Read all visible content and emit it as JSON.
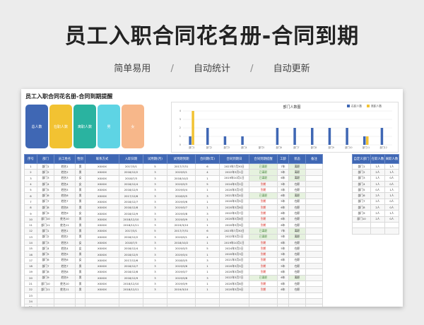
{
  "hero": {
    "title": "员工入职合同花名册-合同到期",
    "features": [
      "简单易用",
      "自动统计",
      "自动更新"
    ],
    "separator": "/"
  },
  "sheet": {
    "title": "员工入职合同花名册-合同到期提醒",
    "cards": [
      {
        "label": "总人数",
        "color": "#3f67b4"
      },
      {
        "label": "在职人数",
        "color": "#f2c232"
      },
      {
        "label": "离职人数",
        "color": "#2ab3a0"
      },
      {
        "label": "男",
        "color": "#5ed4e4"
      },
      {
        "label": "女",
        "color": "#f7b78a"
      }
    ]
  },
  "chart_data": {
    "type": "bar",
    "title": "部门人数图",
    "categories": [
      "部门1",
      "部门2",
      "部门3",
      "部门4",
      "部门5",
      "部门6",
      "部门7",
      "部门8",
      "部门9",
      "部门10",
      "部门11",
      "部门12"
    ],
    "series": [
      {
        "name": "在职人数",
        "color": "#3f67b4",
        "values": [
          1,
          2,
          1,
          1,
          0,
          2,
          2,
          2,
          2,
          2,
          1,
          2
        ]
      },
      {
        "name": "离职人数",
        "color": "#f2c232",
        "values": [
          4,
          0,
          0,
          0,
          0,
          0,
          0,
          0,
          0,
          0,
          1,
          0
        ]
      }
    ],
    "yticks": [
      "0",
      "1",
      "2",
      "3",
      "4"
    ],
    "ylim": [
      0,
      4
    ],
    "legend": "top-right"
  },
  "table": {
    "headers": [
      "序号",
      "部门",
      "员工姓名",
      "性别",
      "联系方式",
      "入职日期",
      "试用期(月)",
      "试用期到期",
      "合同期(年)",
      "合同到期日",
      "合同到期提醒",
      "工龄",
      "状态",
      "备注"
    ],
    "rows": [
      [
        "1",
        "部门1",
        "姓名1",
        "男",
        "XXXXX",
        "2017/3/1",
        "5",
        "2017/7/31",
        "6",
        "2023年7月30日",
        "已离职",
        "7年",
        "离职",
        ""
      ],
      [
        "2",
        "部门2",
        "姓名2",
        "男",
        "XXXXX",
        "2018/12/2",
        "3",
        "2019/3/1",
        "4",
        "2022年3月1日",
        "已离职",
        "5年",
        "离职",
        ""
      ],
      [
        "3",
        "部门3",
        "姓名3",
        "女",
        "XXXXX",
        "2018/7/3",
        "3",
        "2018/10/2",
        "1",
        "2019年10月1日",
        "已离职",
        "6年",
        "离职",
        ""
      ],
      [
        "4",
        "部门4",
        "姓名4",
        "女",
        "XXXXX",
        "2018/12/4",
        "3",
        "2019/3/3",
        "5",
        "2024年3月2日",
        "到期",
        "5年",
        "在职",
        ""
      ],
      [
        "5",
        "部门5",
        "姓名5",
        "男",
        "XXXXX",
        "2018/12/5",
        "3",
        "2019/3/4",
        "1",
        "2020年3月3日",
        "到期",
        "5年",
        "在职",
        ""
      ],
      [
        "6",
        "部门6",
        "姓名6",
        "男",
        "XXXXX",
        "2017/12/6",
        "3",
        "2018/3/5",
        "3",
        "2021年3月4日",
        "已离职",
        "6年",
        "离职",
        ""
      ],
      [
        "7",
        "部门7",
        "姓名7",
        "男",
        "XXXXX",
        "2018/12/7",
        "3",
        "2019/3/6",
        "1",
        "2020年3月5日",
        "到期",
        "5年",
        "在职",
        ""
      ],
      [
        "8",
        "部门8",
        "姓名8",
        "男",
        "XXXXX",
        "2018/12/8",
        "3",
        "2019/3/7",
        "1",
        "2020年3月6日",
        "到期",
        "6年",
        "在职",
        ""
      ],
      [
        "9",
        "部门9",
        "姓名9",
        "女",
        "XXXXX",
        "2018/12/9",
        "3",
        "2019/3/8",
        "3",
        "2022年3月7日",
        "到期",
        "6年",
        "在职",
        ""
      ],
      [
        "10",
        "部门10",
        "姓名10",
        "男",
        "XXXXX",
        "2018/12/10",
        "3",
        "2019/3/9",
        "1",
        "2020年3月8日",
        "到期",
        "6年",
        "在职",
        ""
      ],
      [
        "11",
        "部门11",
        "姓名11",
        "男",
        "XXXXX",
        "2018/12/11",
        "3",
        "2019/3/10",
        "1",
        "2020年3月9日",
        "到期",
        "6年",
        "在职",
        ""
      ],
      [
        "12",
        "部门1",
        "姓名1",
        "男",
        "XXXXX",
        "2017/3/1",
        "5",
        "2017/7/31",
        "6",
        "2023年7月30日",
        "已离职",
        "7年",
        "离职",
        ""
      ],
      [
        "13",
        "部门2",
        "姓名2",
        "男",
        "XXXXX",
        "2018/12/2",
        "3",
        "2019/3/1",
        "4",
        "2022年3月1日",
        "已离职",
        "5年",
        "离职",
        ""
      ],
      [
        "14",
        "部门3",
        "姓名3",
        "女",
        "XXXXX",
        "2018/7/3",
        "3",
        "2018/10/2",
        "1",
        "2019年10月1日",
        "到期",
        "6年",
        "在职",
        ""
      ],
      [
        "15",
        "部门4",
        "姓名4",
        "女",
        "XXXXX",
        "2018/12/4",
        "3",
        "2019/3/3",
        "5",
        "2024年3月2日",
        "到期",
        "5年",
        "在职",
        ""
      ],
      [
        "16",
        "部门5",
        "姓名5",
        "男",
        "XXXXX",
        "2018/12/5",
        "3",
        "2019/3/4",
        "1",
        "2020年3月3日",
        "到期",
        "5年",
        "在职",
        ""
      ],
      [
        "17",
        "部门6",
        "姓名6",
        "女",
        "XXXXX",
        "2017/12/6",
        "3",
        "2018/3/5",
        "3",
        "2021年3月4日",
        "到期",
        "6年",
        "在职",
        ""
      ],
      [
        "18",
        "部门7",
        "姓名7",
        "男",
        "XXXXX",
        "2018/12/7",
        "3",
        "2019/3/6",
        "1",
        "2020年3月5日",
        "到期",
        "5年",
        "在职",
        ""
      ],
      [
        "19",
        "部门8",
        "姓名8",
        "男",
        "XXXXX",
        "2018/12/8",
        "3",
        "2019/3/7",
        "1",
        "2020年3月6日",
        "到期",
        "6年",
        "在职",
        ""
      ],
      [
        "20",
        "部门9",
        "姓名9",
        "男",
        "XXXXX",
        "2018/12/9",
        "3",
        "2019/3/8",
        "3",
        "2022年3月7日",
        "已离职",
        "6年",
        "离职",
        ""
      ],
      [
        "21",
        "部门10",
        "姓名10",
        "男",
        "XXXXX",
        "2018/12/10",
        "3",
        "2019/3/9",
        "1",
        "2020年3月8日",
        "到期",
        "6年",
        "在职",
        ""
      ],
      [
        "22",
        "部门11",
        "姓名11",
        "男",
        "XXXXX",
        "2018/12/11",
        "3",
        "2019/3/10",
        "1",
        "2020年3月9日",
        "到期",
        "6年",
        "在职",
        ""
      ],
      [
        "23",
        "",
        "",
        "",
        "",
        "",
        "",
        "",
        "",
        "",
        "",
        "",
        "",
        ""
      ],
      [
        "24",
        "",
        "",
        "",
        "",
        "",
        "",
        "",
        "",
        "",
        "",
        "",
        "",
        ""
      ],
      [
        "25",
        "",
        "",
        "",
        "",
        "",
        "",
        "",
        "",
        "",
        "",
        "",
        "",
        ""
      ]
    ]
  },
  "side": {
    "headers": [
      "自定义部门",
      "在职人数",
      "离职人数"
    ],
    "rows": [
      [
        "部门1",
        "1人",
        "1人"
      ],
      [
        "部门2",
        "2人",
        "1人"
      ],
      [
        "部门3",
        "1人",
        "0人"
      ],
      [
        "部门4",
        "1人",
        "0人"
      ],
      [
        "部门5",
        "0人",
        "1人"
      ],
      [
        "部门6",
        "2人",
        "1人"
      ],
      [
        "部门7",
        "2人",
        "0人"
      ],
      [
        "部门8",
        "2人",
        "0人"
      ],
      [
        "部门9",
        "2人",
        "1人"
      ],
      [
        "部门10",
        "2人",
        "0人"
      ],
      [
        "",
        "",
        ""
      ],
      [
        "",
        "",
        ""
      ]
    ]
  }
}
